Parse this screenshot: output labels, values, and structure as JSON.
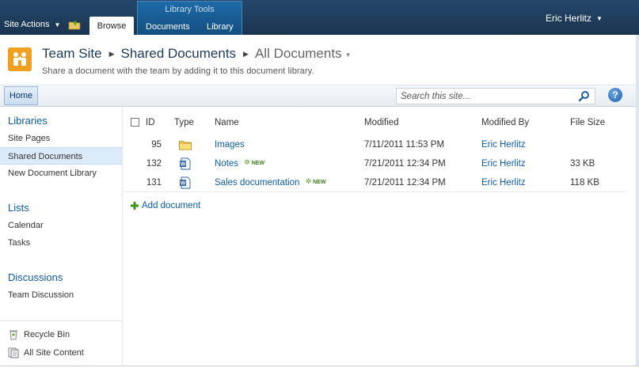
{
  "ribbon": {
    "site_actions": "Site Actions",
    "tab_browse": "Browse",
    "contextual_group": "Library Tools",
    "tab_documents": "Documents",
    "tab_library": "Library",
    "user": "Eric Herlitz"
  },
  "header": {
    "crumbs": [
      "Team Site",
      "Shared Documents",
      "All Documents"
    ],
    "description": "Share a document with the team by adding it to this document library."
  },
  "topnav": {
    "home": "Home",
    "search_placeholder": "Search this site...",
    "help": "?"
  },
  "leftnav": {
    "libraries_header": "Libraries",
    "libraries": [
      "Site Pages",
      "Shared Documents",
      "New Document Library"
    ],
    "lists_header": "Lists",
    "lists": [
      "Calendar",
      "Tasks"
    ],
    "discussions_header": "Discussions",
    "discussions": [
      "Team Discussion"
    ],
    "recycle_bin": "Recycle Bin",
    "all_site_content": "All Site Content"
  },
  "list": {
    "columns": [
      "ID",
      "Type",
      "Name",
      "Modified",
      "Modified By",
      "File Size"
    ],
    "rows": [
      {
        "id": "95",
        "type": "folder-icon",
        "name": "Images",
        "new": "",
        "modified": "7/11/2011 11:53 PM",
        "modified_by": "Eric Herlitz",
        "size": ""
      },
      {
        "id": "132",
        "type": "word-doc-icon",
        "name": "Notes",
        "new": "NEW",
        "modified": "7/21/2011 12:34 PM",
        "modified_by": "Eric Herlitz",
        "size": "33 KB"
      },
      {
        "id": "131",
        "type": "word-doc-icon",
        "name": "Sales documentation",
        "new": "NEW",
        "modified": "7/21/2011 12:34 PM",
        "modified_by": "Eric Herlitz",
        "size": "118 KB"
      }
    ],
    "add_document": "Add document"
  },
  "colors": {
    "ribbon": "#1f3a56",
    "link": "#0e5ca3",
    "logo": "#f0a020",
    "selected_nav": "#dcebf9"
  }
}
